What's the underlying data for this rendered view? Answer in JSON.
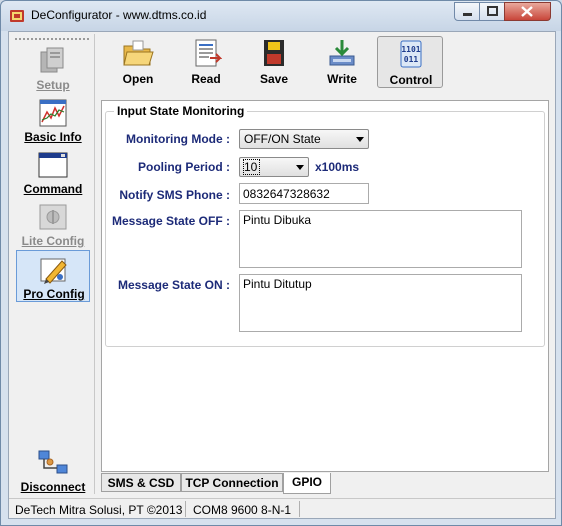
{
  "window": {
    "title": "DeConfigurator - www.dtms.co.id"
  },
  "sidebar": {
    "items": [
      {
        "label": "Setup",
        "icon": "setup-icon",
        "enabled": false
      },
      {
        "label": "Basic Info",
        "icon": "chart-icon",
        "enabled": true
      },
      {
        "label": "Command",
        "icon": "command-window-icon",
        "enabled": true
      },
      {
        "label": "Lite Config",
        "icon": "lite-config-icon",
        "enabled": false
      },
      {
        "label": "Pro Config",
        "icon": "pro-config-icon",
        "enabled": true,
        "selected": true
      }
    ],
    "disconnect_label": "Disconnect"
  },
  "toolbar": {
    "buttons": [
      {
        "label": "Open",
        "icon": "folder-open-icon"
      },
      {
        "label": "Read",
        "icon": "read-document-icon"
      },
      {
        "label": "Save",
        "icon": "floppy-save-icon"
      },
      {
        "label": "Write",
        "icon": "write-icon"
      },
      {
        "label": "Control",
        "icon": "binary-control-icon",
        "pressed": true
      }
    ]
  },
  "group": {
    "title": "Input State Monitoring"
  },
  "form": {
    "monitoring_mode_label": "Monitoring Mode :",
    "monitoring_mode_value": "OFF/ON State",
    "pooling_period_label": "Pooling Period :",
    "pooling_period_value": "10",
    "pooling_period_unit": "x100ms",
    "notify_phone_label": "Notify SMS Phone :",
    "notify_phone_value": "0832647328632",
    "msg_off_label": "Message State OFF :",
    "msg_off_value": "Pintu Dibuka",
    "msg_on_label": "Message State ON :",
    "msg_on_value": "Pintu Ditutup"
  },
  "tabs": [
    {
      "label": "SMS & CSD"
    },
    {
      "label": "TCP Connection"
    },
    {
      "label": "GPIO",
      "active": true
    }
  ],
  "status": {
    "company": "DeTech Mitra Solusi, PT ©2013",
    "port": "COM8 9600 8-N-1"
  }
}
